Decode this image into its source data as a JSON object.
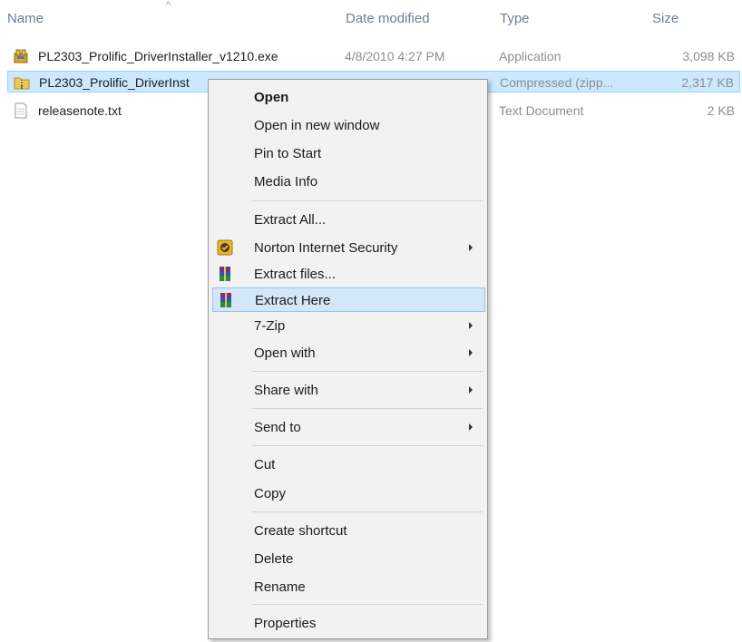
{
  "columns": {
    "name": "Name",
    "date_modified": "Date modified",
    "type": "Type",
    "size": "Size"
  },
  "files": [
    {
      "name": "PL2303_Prolific_DriverInstaller_v1210.exe",
      "date": "4/8/2010 4:27 PM",
      "type": "Application",
      "size": "3,098 KB",
      "icon": "installer-icon",
      "selected": false
    },
    {
      "name": "PL2303_Prolific_DriverInst",
      "date": "",
      "type": "Compressed (zipp...",
      "size": "2,317 KB",
      "icon": "zip-folder-icon",
      "selected": true
    },
    {
      "name": "releasenote.txt",
      "date": "",
      "type": "Text Document",
      "size": "2 KB",
      "icon": "text-file-icon",
      "selected": false
    }
  ],
  "context_menu": {
    "items": [
      {
        "label": "Open",
        "bold": true
      },
      {
        "label": "Open in new window"
      },
      {
        "label": "Pin to Start"
      },
      {
        "label": "Media Info"
      },
      {
        "label": "Extract All..."
      },
      {
        "label": "Norton Internet Security",
        "submenu": true,
        "icon": "norton-icon"
      },
      {
        "label": "Extract files...",
        "icon": "winrar-icon"
      },
      {
        "label": "Extract Here",
        "icon": "winrar-icon",
        "highlighted": true
      },
      {
        "label": "7-Zip",
        "submenu": true
      },
      {
        "label": "Open with",
        "submenu": true
      },
      {
        "label": "Share with",
        "submenu": true
      },
      {
        "label": "Send to",
        "submenu": true
      },
      {
        "label": "Cut"
      },
      {
        "label": "Copy"
      },
      {
        "label": "Create shortcut"
      },
      {
        "label": "Delete"
      },
      {
        "label": "Rename"
      },
      {
        "label": "Properties"
      }
    ]
  },
  "colors": {
    "selection_bg": "#cce8ff",
    "menu_highlight_bg": "#d4e7f8",
    "header_text": "#6d7e94"
  }
}
